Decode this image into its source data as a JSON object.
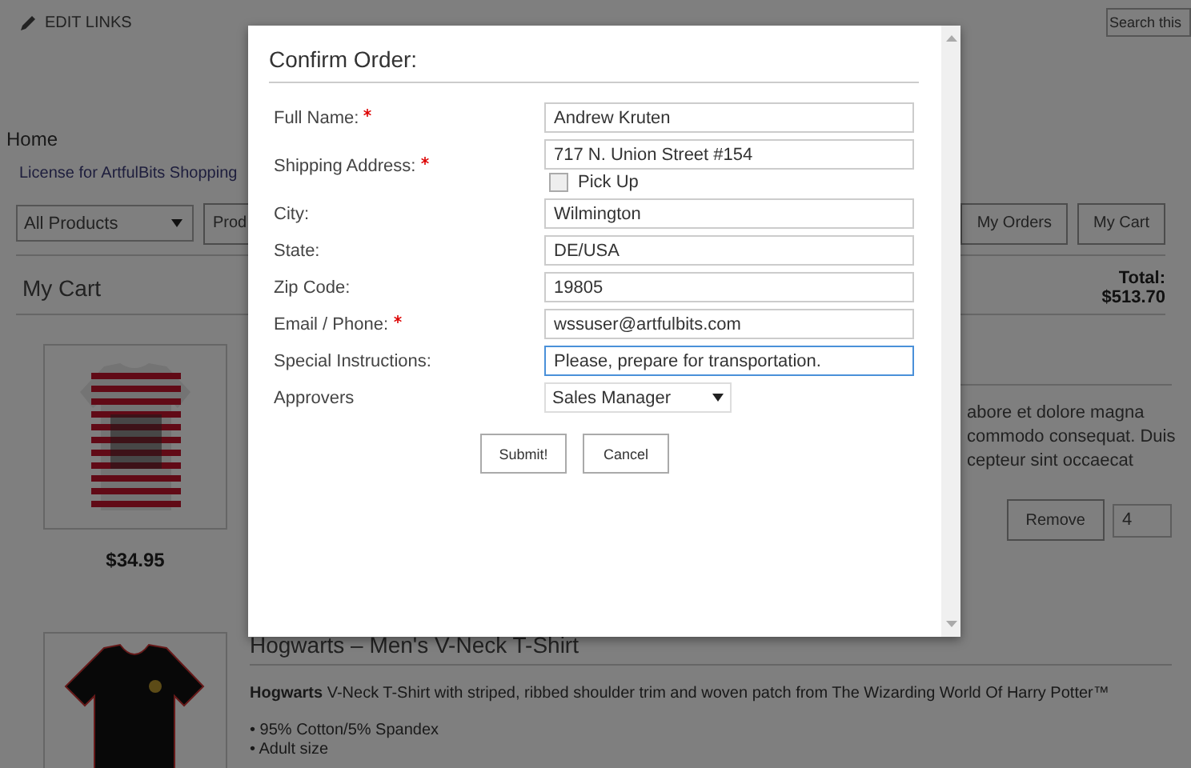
{
  "top_bar": {
    "edit_links": "EDIT LINKS",
    "search": {
      "placeholder": "Search this"
    }
  },
  "breadcrumb": "Home",
  "license_link": "License for ArtfulBits Shopping",
  "toolbar": {
    "category": "All Products",
    "buttons_left": [
      "Prod"
    ],
    "buttons_right": [
      "My Orders",
      "My Cart"
    ]
  },
  "cart": {
    "title": "My Cart",
    "total_label": "Total:",
    "total": "$513.70",
    "items": [
      {
        "price": "$34.95",
        "description_lines": [
          "abore et dolore magna",
          "commodo consequat. Duis",
          "cepteur sint occaecat"
        ],
        "remove": "Remove",
        "quantity": "4"
      },
      {
        "title": "Hogwarts – Men's V-Neck T-Shirt",
        "description": "**Hogwarts** V-Neck T-Shirt with striped, ribbed shoulder trim and woven patch from The Wizarding World Of Harry Potter™",
        "bullets": [
          "• 95% Cotton/5% Spandex",
          "• Adult size"
        ]
      }
    ]
  },
  "dialog": {
    "title": "Confirm Order:",
    "fields": [
      {
        "kind": "text",
        "label": "Full Name:",
        "required": true,
        "value": "Andrew Kruten",
        "focused": false
      },
      {
        "kind": "text",
        "label": "Shipping Address:",
        "required": true,
        "value": "717 N. Union Street #154",
        "focused": false,
        "option": {
          "label": "Pick Up",
          "checked": false
        }
      },
      {
        "kind": "text",
        "label": "City:",
        "required": false,
        "value": "Wilmington",
        "focused": false
      },
      {
        "kind": "text",
        "label": "State:",
        "required": false,
        "value": "DE/USA",
        "focused": false
      },
      {
        "kind": "text",
        "label": "Zip Code:",
        "required": false,
        "value": "19805",
        "focused": false
      },
      {
        "kind": "text",
        "label": "Email / Phone:",
        "required": true,
        "value": "wssuser@artfulbits.com",
        "focused": false
      },
      {
        "kind": "text",
        "label": "Special Instructions:",
        "required": false,
        "value": "Please, prepare for transportation.",
        "focused": true
      },
      {
        "kind": "select",
        "label": "Approvers",
        "required": false,
        "value": "Sales Manager",
        "focused": false
      }
    ],
    "buttons": [
      "Submit!",
      "Cancel"
    ]
  }
}
